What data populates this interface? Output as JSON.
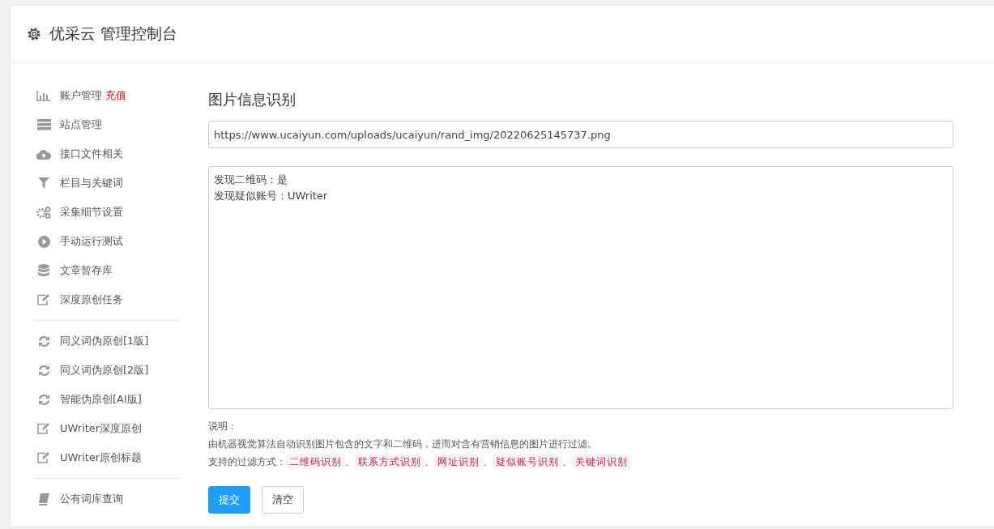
{
  "header": {
    "title": "优采云 管理控制台"
  },
  "sidebar": {
    "groups": [
      {
        "items": [
          {
            "label": "账户管理",
            "badge": "充值"
          },
          {
            "label": "站点管理"
          },
          {
            "label": "接口文件相关"
          },
          {
            "label": "栏目与关键词"
          },
          {
            "label": "采集细节设置"
          },
          {
            "label": "手动运行测试"
          },
          {
            "label": "文章暂存库"
          },
          {
            "label": "深度原创任务"
          }
        ]
      },
      {
        "items": [
          {
            "label": "同义词伪原创[1版]"
          },
          {
            "label": "同义词伪原创[2版]"
          },
          {
            "label": "智能伪原创[AI版]"
          },
          {
            "label": "UWriter深度原创"
          },
          {
            "label": "UWriter原创标题"
          }
        ]
      },
      {
        "items": [
          {
            "label": "公有词库查询"
          }
        ]
      }
    ]
  },
  "main": {
    "title": "图片信息识别",
    "url_field": {
      "value": "https://www.ucaiyun.com/uploads/ucaiyun/rand_img/20220625145737.png"
    },
    "result_box": {
      "lines": [
        "发现二维码：是",
        "发现疑似账号：UWriter"
      ]
    },
    "note_label": "说明：",
    "description": "由机器视觉算法自动识别图片包含的文字和二维码，进而对含有营销信息的图片进行过滤。",
    "filters_label": "支持的过滤方式：",
    "filters": [
      "二维码识别",
      "联系方式识别",
      "网址识别",
      "疑似账号识别",
      "关键词识别"
    ],
    "filter_separator": "、",
    "buttons": [
      {
        "label": "提交",
        "kind": "primary"
      },
      {
        "label": "清空",
        "kind": "default"
      }
    ]
  }
}
